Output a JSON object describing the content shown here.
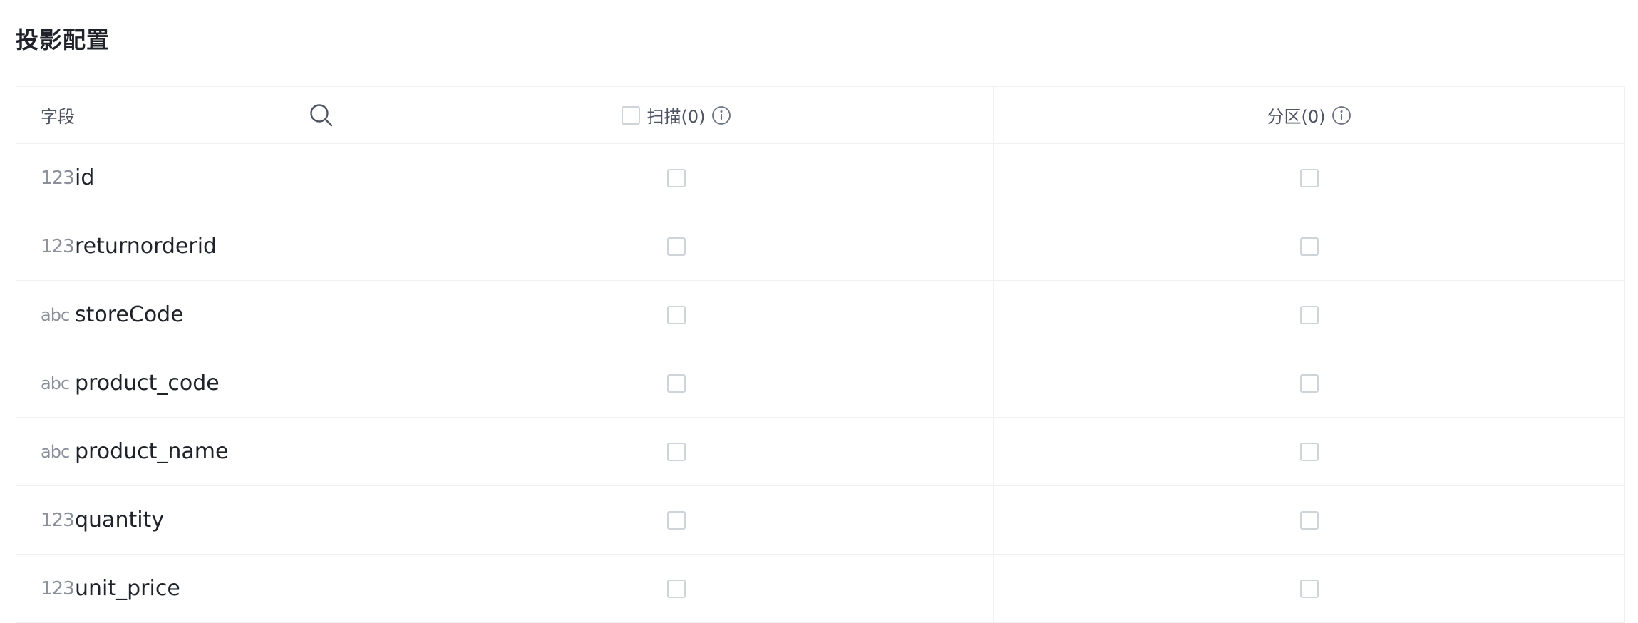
{
  "title": "投影配置",
  "columns": {
    "field": "字段",
    "scan": "扫描(0)",
    "partition": "分区(0)"
  },
  "rows": [
    {
      "type": "123",
      "name": "id"
    },
    {
      "type": "123",
      "name": "returnorderid"
    },
    {
      "type": "abc",
      "name": "storeCode"
    },
    {
      "type": "abc",
      "name": "product_code"
    },
    {
      "type": "abc",
      "name": "product_name"
    },
    {
      "type": "123",
      "name": "quantity"
    },
    {
      "type": "123",
      "name": "unit_price"
    }
  ],
  "icons": {
    "search": "search-icon",
    "info": "info-icon"
  },
  "colors": {
    "border": "#eef0f3",
    "checkbox_border": "#cfd3da",
    "type_tag": "#8a8f99",
    "text": "#1f2329"
  }
}
